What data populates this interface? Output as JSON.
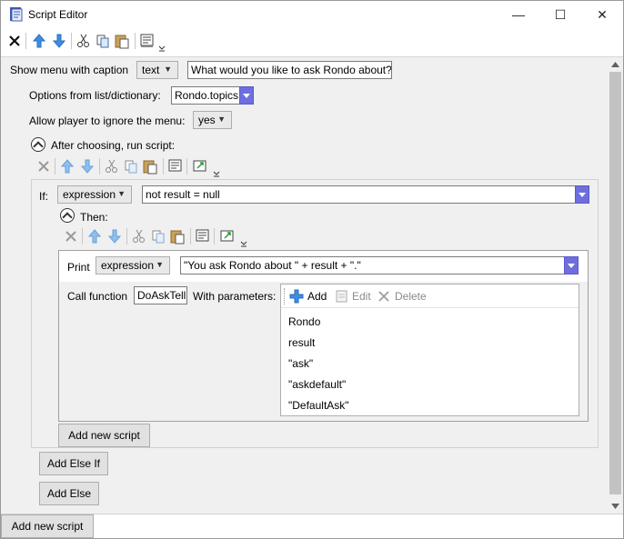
{
  "window": {
    "title": "Script Editor",
    "minimize_glyph": "—",
    "maximize_glyph": "☐",
    "close_glyph": "✕"
  },
  "main": {
    "show_menu_label": "Show menu with caption",
    "caption_type": "text",
    "caption_value": "What would you like to ask Rondo about?",
    "options_label": "Options from list/dictionary:",
    "options_value": "Rondo.topics",
    "allow_ignore_label": "Allow player to ignore the menu:",
    "allow_ignore_value": "yes",
    "after_choosing_label": "After choosing, run script:"
  },
  "if_block": {
    "if_label": "If:",
    "if_type": "expression",
    "if_value": "not result = null",
    "then_label": "Then:"
  },
  "inner": {
    "print_label": "Print",
    "print_type": "expression",
    "print_value": "\"You ask Rondo about \" + result + \".\"",
    "call_label": "Call function",
    "call_value": "DoAskTell",
    "with_params_label": "With parameters:",
    "add_label": "Add",
    "edit_label": "Edit",
    "delete_label": "Delete",
    "params": [
      "Rondo",
      "result",
      "\"ask\"",
      "\"askdefault\"",
      "\"DefaultAsk\""
    ]
  },
  "buttons": {
    "add_new_script_inner": "Add new script",
    "add_else_if": "Add Else If",
    "add_else": "Add Else",
    "add_new_script_bottom": "Add new script"
  }
}
